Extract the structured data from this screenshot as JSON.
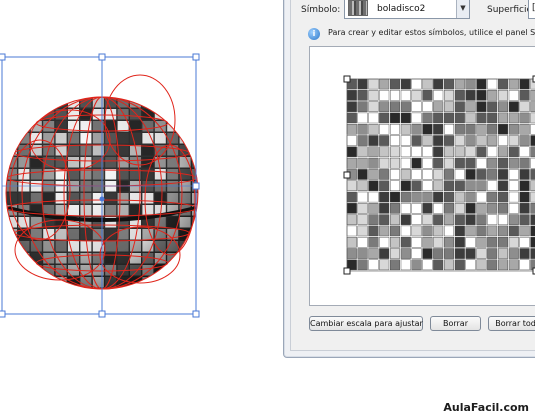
{
  "dialog": {
    "symbol_label": "Símbolo:",
    "symbol_value": "boladisco2",
    "surface_label": "Superficie:",
    "surface_value": "[-",
    "info_text": "Para crear y editar estos símbolos, utilice el panel Símb",
    "buttons": {
      "scale": "Cambiar escala para ajustar",
      "delete": "Borrar",
      "delete_all": "Borrar todo"
    }
  },
  "icons": {
    "info": "info-icon",
    "dropdown": "chevron-down-icon"
  },
  "colors": {
    "selection": "#4a78d6",
    "wireframe": "#e0251b",
    "tile_light": "#ffffff",
    "tile_dark": "#2b2b2b"
  },
  "watermark": "AulaFacil.com"
}
